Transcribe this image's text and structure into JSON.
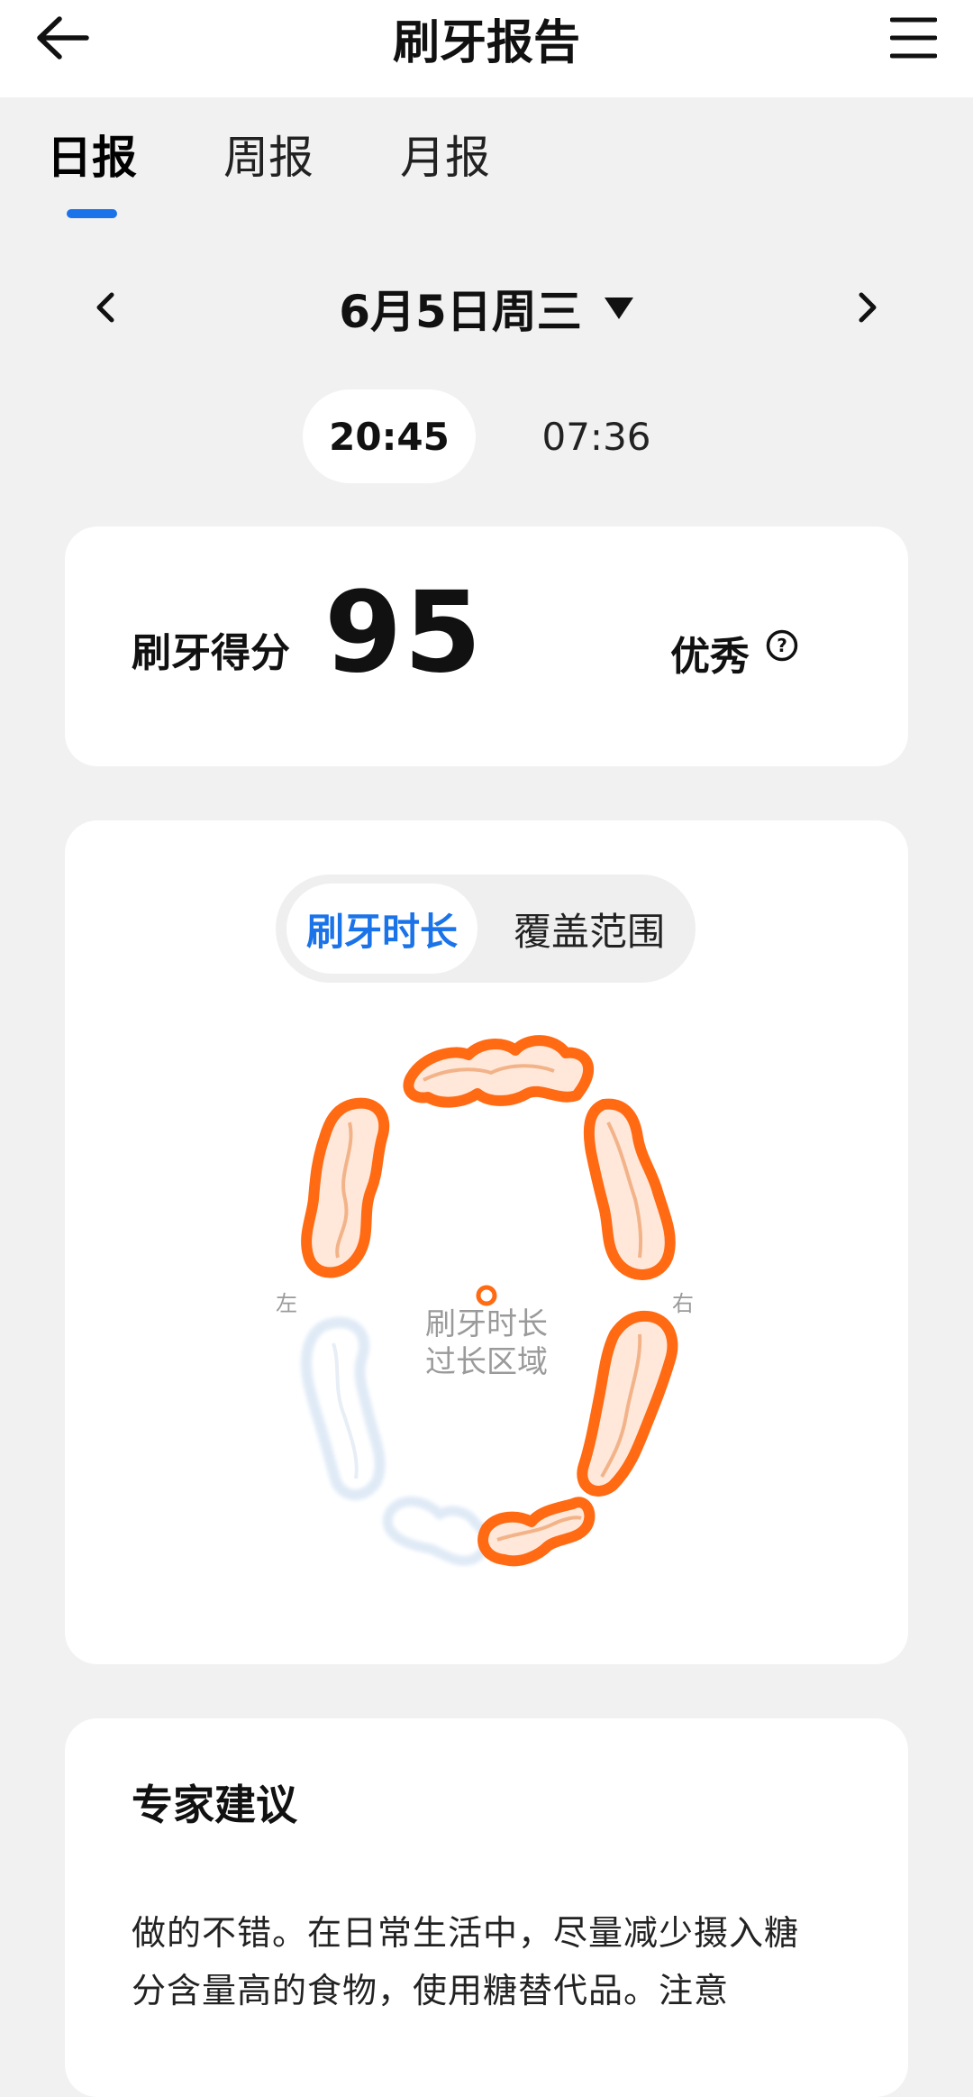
{
  "header": {
    "title": "刷牙报告",
    "back_icon": "arrow-left-icon",
    "menu_icon": "hamburger-menu-icon"
  },
  "tabs": [
    {
      "label": "日报",
      "active": true
    },
    {
      "label": "周报",
      "active": false
    },
    {
      "label": "月报",
      "active": false
    }
  ],
  "date_nav": {
    "date": "6月5日周三",
    "prev_icon": "chevron-left-icon",
    "next_icon": "chevron-right-icon",
    "dropdown_icon": "caret-down-icon"
  },
  "sessions": [
    {
      "time": "20:45",
      "selected": true
    },
    {
      "time": "07:36",
      "selected": false
    }
  ],
  "score": {
    "label": "刷牙得分",
    "value": "95",
    "grade": "优秀",
    "help_icon": "question-circle-icon"
  },
  "coverage": {
    "toggle": [
      {
        "label": "刷牙时长",
        "selected": true
      },
      {
        "label": "覆盖范围",
        "selected": false
      }
    ],
    "left_label": "左",
    "right_label": "右",
    "legend_line1": "刷牙时长",
    "legend_line2": "过长区域",
    "colors": {
      "highlight": "#ff6a13",
      "normal": "#dfeaf6",
      "accent": "#1a73e8"
    },
    "zones": [
      {
        "name": "upper-front",
        "state": "over"
      },
      {
        "name": "upper-left",
        "state": "over"
      },
      {
        "name": "upper-right",
        "state": "over"
      },
      {
        "name": "lower-left",
        "state": "normal"
      },
      {
        "name": "lower-right",
        "state": "over"
      },
      {
        "name": "lower-front-left",
        "state": "normal"
      },
      {
        "name": "lower-front-right",
        "state": "over"
      }
    ]
  },
  "advice": {
    "title": "专家建议",
    "text": "做的不错。在日常生活中，尽量减少摄入糖分含量高的食物，使用糖替代品。注意"
  }
}
